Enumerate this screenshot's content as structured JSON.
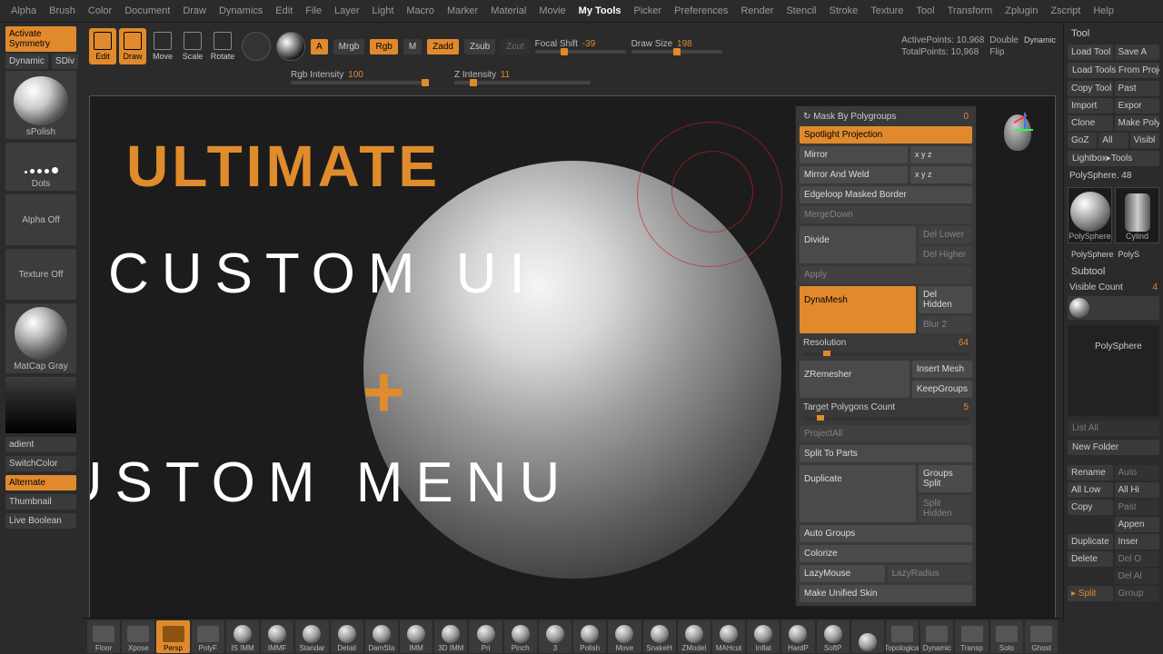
{
  "menu": [
    "Alpha",
    "Brush",
    "Color",
    "Document",
    "Draw",
    "Dynamics",
    "Edit",
    "File",
    "Layer",
    "Light",
    "Macro",
    "Marker",
    "Material",
    "Movie",
    "My Tools",
    "Picker",
    "Preferences",
    "Render",
    "Stencil",
    "Stroke",
    "Texture",
    "Tool",
    "Transform",
    "Zplugin",
    "Zscript",
    "Help"
  ],
  "menu_active_index": 14,
  "left": {
    "activate_sym": "Activate Symmetry",
    "dynamic": "Dynamic",
    "sdiv": "SDiv",
    "brush": "sPolish",
    "stroke": "Dots",
    "alpha": "Alpha Off",
    "texture": "Texture Off",
    "material": "MatCap Gray",
    "gradient": "adient",
    "switchcolor": "SwitchColor",
    "alternate": "Alternate",
    "thumbnail": "Thumbnail",
    "boolean": "Live Boolean"
  },
  "modes": [
    {
      "l": "Edit",
      "active": true
    },
    {
      "l": "Draw",
      "active": true
    },
    {
      "l": "Move",
      "active": false
    },
    {
      "l": "Scale",
      "active": false
    },
    {
      "l": "Rotate",
      "active": false
    }
  ],
  "paint": {
    "a": "A",
    "mrgb": "Mrgb",
    "rgb": "Rgb",
    "m": "M",
    "zadd": "Zadd",
    "zsub": "Zsub",
    "zcut": "Zcut"
  },
  "sliders": {
    "rgb_label": "Rgb Intensity",
    "rgb_val": "100",
    "rgb_pct": 96,
    "z_label": "Z Intensity",
    "z_val": "11",
    "z_pct": 11,
    "focal_label": "Focal Shift",
    "focal_val": "-39",
    "focal_pct": 28,
    "draw_label": "Draw Size",
    "draw_val": "198",
    "draw_pct": 46
  },
  "stats": {
    "active_l": "ActivePoints:",
    "active_v": "10,968",
    "total_l": "TotalPoints:",
    "total_v": "10,968",
    "double": "Double",
    "flip": "Flip",
    "dynamic": "Dynamic"
  },
  "overlay": {
    "ultimate": "ULTIMATE",
    "custom_ui": "CUSTOM UI",
    "plus": "+",
    "custom_menu": "CUSTOM MENU"
  },
  "floating": {
    "mask_label": "Mask By Polygroups",
    "mask_val": "0",
    "spotlight": "Spotlight Projection",
    "mirror": "Mirror",
    "mirror_weld": "Mirror And Weld",
    "edgeloop": "Edgeloop Masked Border",
    "mergedown": "MergeDown",
    "divide": "Divide",
    "del_lower": "Del Lower",
    "del_higher": "Del Higher",
    "apply": "Apply",
    "dynamesh": "DynaMesh",
    "del_hidden": "Del Hidden",
    "blur": "Blur 2",
    "res_label": "Resolution",
    "res_val": "64",
    "zremesher": "ZRemesher",
    "insert_mesh": "Insert Mesh",
    "keep_groups": "KeepGroups",
    "tpc_label": "Target Polygons Count",
    "tpc_val": "5",
    "projectall": "ProjectAll",
    "split_parts": "Split To Parts",
    "duplicate": "Duplicate",
    "groups_split": "Groups Split",
    "split_hidden": "Split Hidden",
    "auto_groups": "Auto Groups",
    "colorize": "Colorize",
    "lazymouse": "LazyMouse",
    "lazyradius": "LazyRadius",
    "unified": "Make Unified Skin"
  },
  "right": {
    "tool": "Tool",
    "load": "Load Tool",
    "save": "Save A",
    "load_proj": "Load Tools From Projec",
    "copy": "Copy Tool",
    "paste": "Past",
    "import": "Import",
    "export": "Expor",
    "clone": "Clone",
    "makepm": "Make PolyMes",
    "goz": "GoZ",
    "all": "All",
    "visib": "Visibl",
    "lightbox": "Lightbox▸Tools",
    "polysphere_n": "PolySphere. 48",
    "polysphere": "PolySphere",
    "polys": "PolyS",
    "cylind": "Cylind",
    "subtool": "Subtool",
    "vis_label": "Visible Count",
    "vis_val": "4",
    "sub_name": "PolySphere",
    "listall": "List All",
    "newfolder": "New Folder",
    "rename": "Rename",
    "auto": "Auto",
    "alllow": "All Low",
    "allhi": "All Hi",
    "copy2": "Copy",
    "paste2": "Past",
    "append": "Appen",
    "duplicate": "Duplicate",
    "insert": "Inser",
    "delete": "Delete",
    "delo": "Del O",
    "delal": "Del Al",
    "split": "Split",
    "group": "Group"
  },
  "shelf": [
    "Floor",
    "Xpose",
    "Persp",
    "PolyF",
    "IS IMM",
    "IMMF",
    "Standar",
    "Detail",
    "DamSta",
    "IMM",
    "3D IMM",
    "Pri",
    "Pinch",
    "3",
    "Polish",
    "Move",
    "SnakeH",
    "ZModel",
    "MAHcut",
    "Inflat",
    "HardP",
    "SoftP",
    "",
    "Topological",
    "Dynamic",
    "Transp",
    "Solo",
    "Ghost"
  ],
  "shelf_orange_idx": 2
}
